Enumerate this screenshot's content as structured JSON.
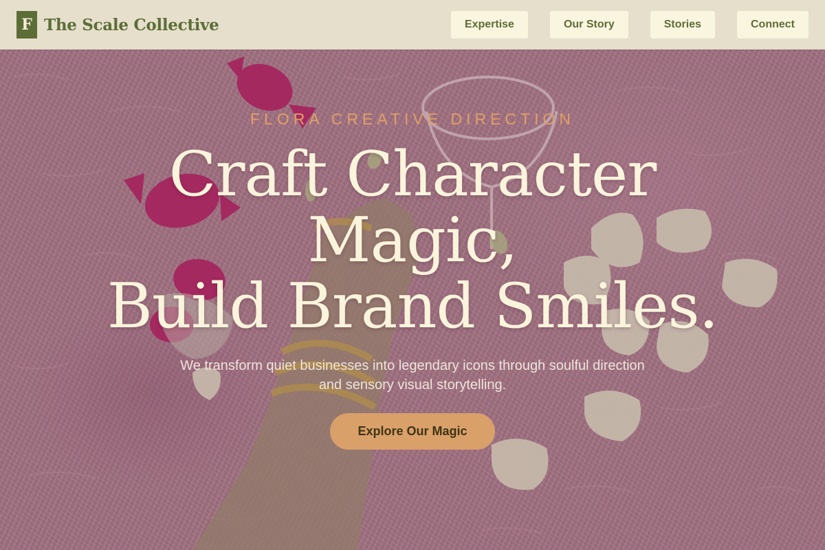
{
  "header": {
    "logo_letter": "F",
    "brand_name": "The Scale Collective",
    "nav": [
      {
        "label": "Expertise"
      },
      {
        "label": "Our Story"
      },
      {
        "label": "Stories"
      },
      {
        "label": "Connect"
      }
    ]
  },
  "hero": {
    "eyebrow": "FLORA CREATIVE DIRECTION",
    "headline_lines": [
      "Craft Character",
      "Magic,",
      "Build Brand Smiles."
    ],
    "subtitle": "We transform quiet businesses into legendary icons through soulful direction and sensory visual storytelling.",
    "cta_label": "Explore Our Magic"
  },
  "colors": {
    "header_bg": "#e5dfcc",
    "brand_green": "#5d6d37",
    "nav_button_bg": "#faf5df",
    "accent_orange": "#daa06a",
    "headline_cream": "#fbf4dc",
    "hero_pink": "#b07e90"
  }
}
